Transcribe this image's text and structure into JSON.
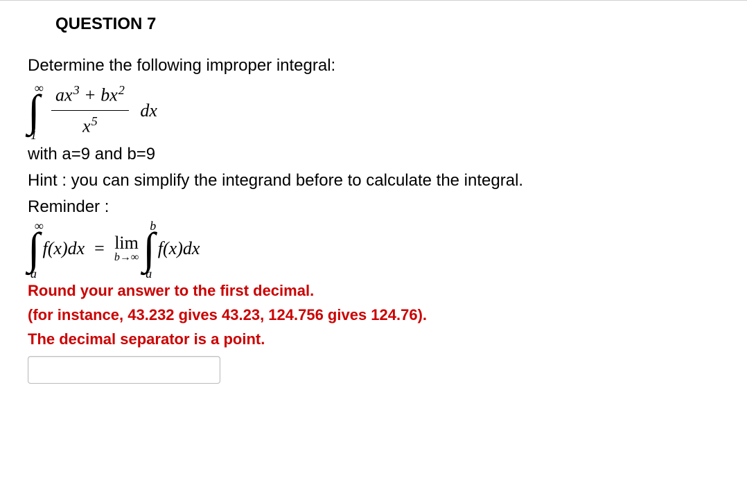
{
  "question": {
    "title": "QUESTION 7",
    "prompt": "Determine the following improper integral:",
    "integral": {
      "upper": "∞",
      "lower": "1",
      "numerator_a_var": "ax",
      "numerator_a_exp": "3",
      "numerator_plus": " + ",
      "numerator_b_var": "bx",
      "numerator_b_exp": "2",
      "denominator_var": "x",
      "denominator_exp": "5",
      "dx": "dx"
    },
    "params": "with a=9 and b=9",
    "hint": "Hint : you can simplify the integrand before to calculate the integral.",
    "reminder_label": "Reminder :",
    "reminder_math": {
      "left_upper": "∞",
      "left_lower": "a",
      "left_fx": "f(x)dx",
      "limit_top": "lim",
      "limit_bottom": "b→∞",
      "right_upper": "b",
      "right_lower": "a",
      "right_fx": "f(x)dx"
    },
    "instructions": {
      "round": "Round your answer to the first decimal.",
      "example": "(for instance, 43.232 gives 43.23, 124.756 gives 124.76).",
      "separator": "The decimal separator is a point."
    },
    "answer_value": ""
  }
}
